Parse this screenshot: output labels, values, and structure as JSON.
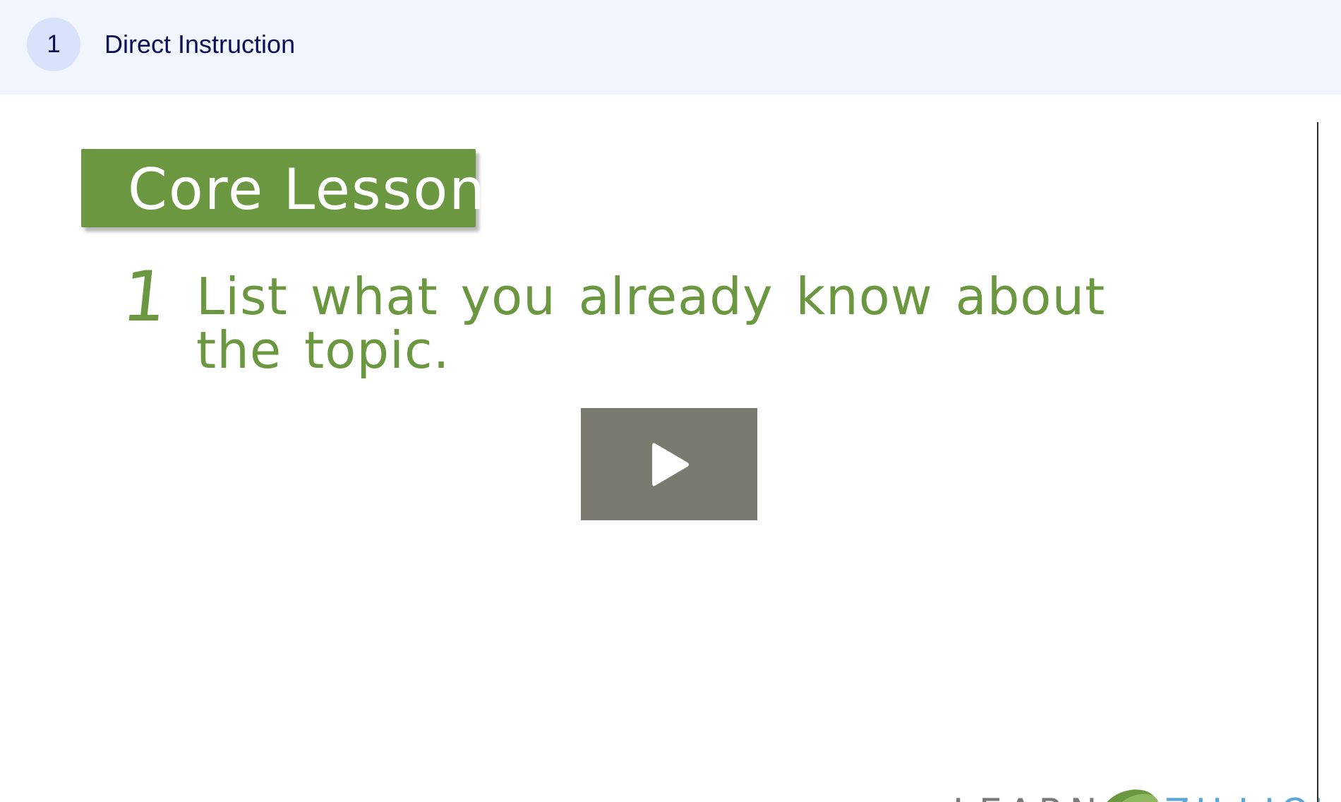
{
  "step": {
    "number": "1",
    "title": "Direct Instruction"
  },
  "video": {
    "banner_label": "Core Lesson",
    "lesson_number": "1",
    "lesson_text": "List what you already know about the topic.",
    "play_icon": "play-icon",
    "logo_text": "LEARNZILLION"
  },
  "colors": {
    "header_bg": "#f1f5fd",
    "step_circle_bg": "#d8e2fa",
    "title_text": "#0c0f58",
    "lesson_green": "#6a9740",
    "play_button_bg": "#7b7a6f"
  }
}
